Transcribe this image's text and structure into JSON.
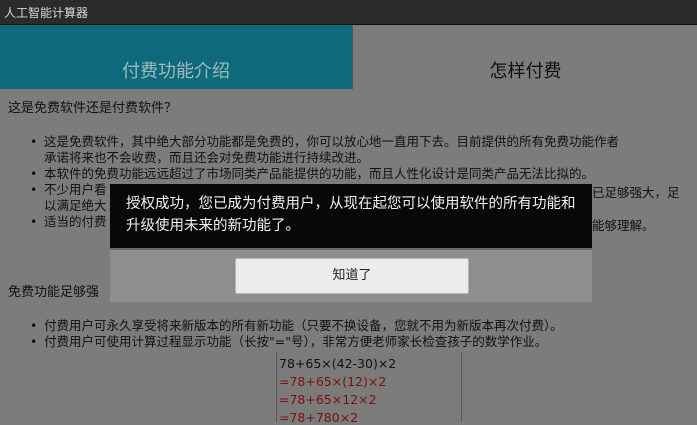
{
  "app": {
    "title": "人工智能计算器"
  },
  "tabs": [
    {
      "label": "付费功能介绍",
      "selected": true
    },
    {
      "label": "怎样付费",
      "selected": false
    }
  ],
  "content": {
    "q1": "这是免费软件还是付费软件？",
    "bullets1": [
      "这是免费软件，其中绝大部分功能都是免费的，你可以放心地一直用下去。目前提供的所有免费功能作者",
      "承诺将来也不会收费，而且还会对免费功能进行持续改进。",
      "本软件的免费功能远远超过了市场同类产品能提供的功能，而且人性化设计是同类产品无法比拟的。",
      "不少用户看",
      "以满足绝大",
      "适当的付费"
    ],
    "bullets1_tail": [
      "已足够强大，足",
      "",
      "能够理解。"
    ],
    "q2": "免费功能足够强",
    "bullets2": [
      "付费用户可永久享受将来新版本的所有新功能（只要不换设备，您就不用为新版本再次付费）。",
      "付费用户可使用计算过程显示功能（长按\"=\"号），非常方便老师家长检查孩子的数学作业。"
    ],
    "calc_lines": [
      "78+65×(42-30)×2",
      "=78+65×(12)×2",
      "=78+65×12×2",
      "=78+780×2"
    ]
  },
  "dialog": {
    "message": "授权成功，您已成为付费用户，从现在起您可以使用软件的所有功能和升级使用未来的新功能了。",
    "button": "知道了"
  }
}
